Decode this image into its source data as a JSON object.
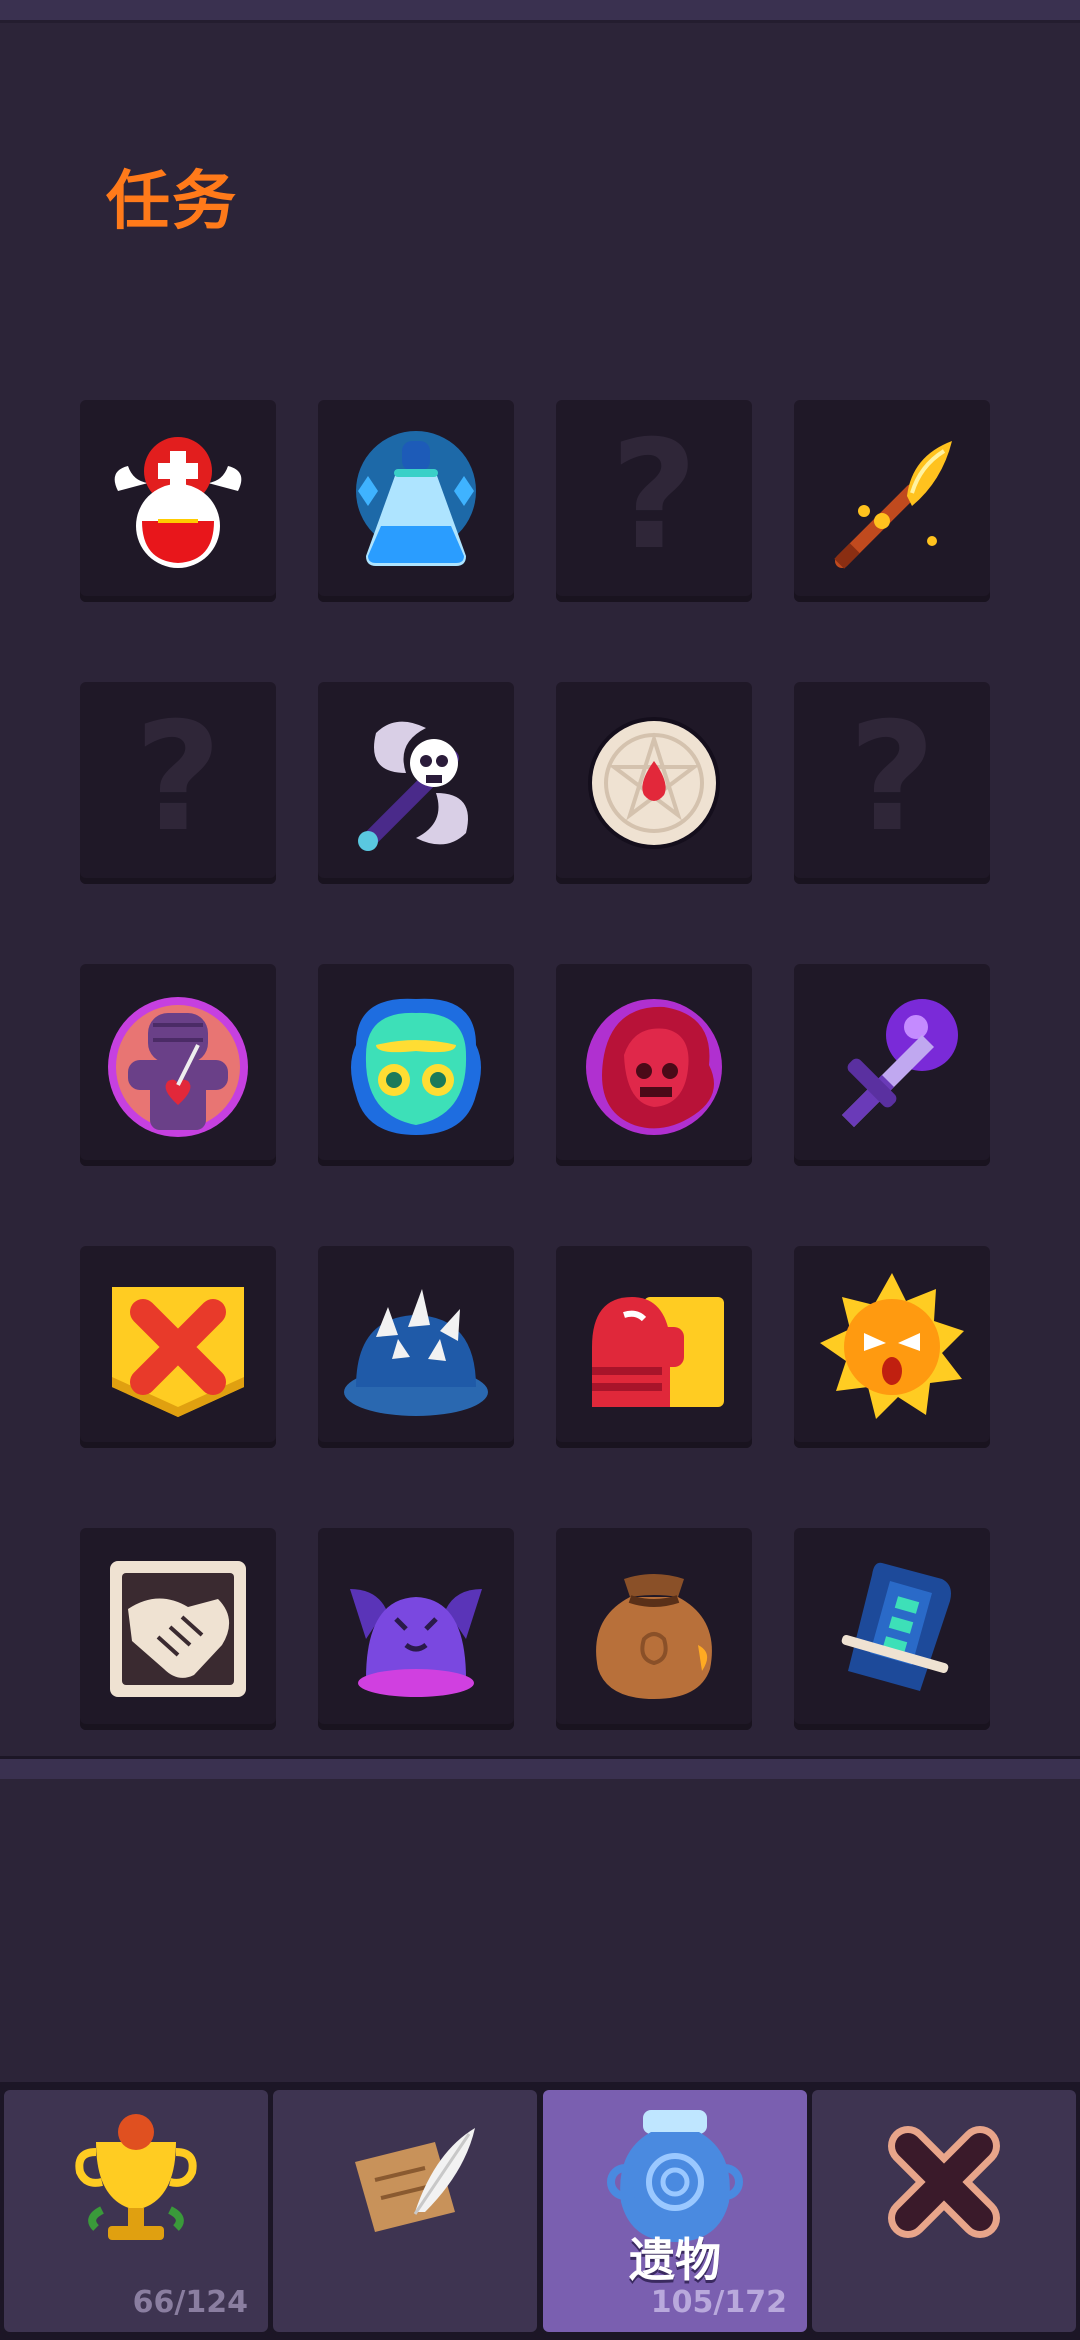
{
  "screen": {
    "title": "任务"
  },
  "relic_grid": {
    "items": [
      {
        "name": "winged-heart-potion-icon",
        "locked": false
      },
      {
        "name": "blue-mana-potion-icon",
        "locked": false
      },
      {
        "name": "locked-relic-icon",
        "locked": true,
        "text": "?"
      },
      {
        "name": "golden-spear-icon",
        "locked": false
      },
      {
        "name": "locked-relic-icon",
        "locked": true,
        "text": "?"
      },
      {
        "name": "skull-battle-axe-icon",
        "locked": false
      },
      {
        "name": "pentagram-disc-icon",
        "locked": false
      },
      {
        "name": "locked-relic-icon",
        "locked": true,
        "text": "?"
      },
      {
        "name": "voodoo-doll-icon",
        "locked": false
      },
      {
        "name": "spirit-mask-icon",
        "locked": false
      },
      {
        "name": "red-reaper-icon",
        "locked": false
      },
      {
        "name": "purple-sword-orb-icon",
        "locked": false
      },
      {
        "name": "cross-shield-icon",
        "locked": false
      },
      {
        "name": "spiked-helmet-icon",
        "locked": false
      },
      {
        "name": "red-fist-icon",
        "locked": false
      },
      {
        "name": "angry-sun-icon",
        "locked": false
      },
      {
        "name": "handshake-card-icon",
        "locked": false
      },
      {
        "name": "purple-demon-hat-icon",
        "locked": false
      },
      {
        "name": "leather-sack-icon",
        "locked": false
      },
      {
        "name": "blue-tombstone-icon",
        "locked": false
      }
    ]
  },
  "tabs": [
    {
      "name": "trophies",
      "count": "66/124",
      "label": "",
      "active": false
    },
    {
      "name": "quests",
      "count": "",
      "label": "",
      "active": false
    },
    {
      "name": "relics",
      "count": "105/172",
      "label": "遗物",
      "active": true
    },
    {
      "name": "close",
      "count": "",
      "label": "",
      "active": false
    }
  ],
  "colors": {
    "background": "#2c2438",
    "tile": "#1f1827",
    "title": "#ff7a1a",
    "tab": "#3e3451",
    "tab_active": "#7a5fb0"
  }
}
